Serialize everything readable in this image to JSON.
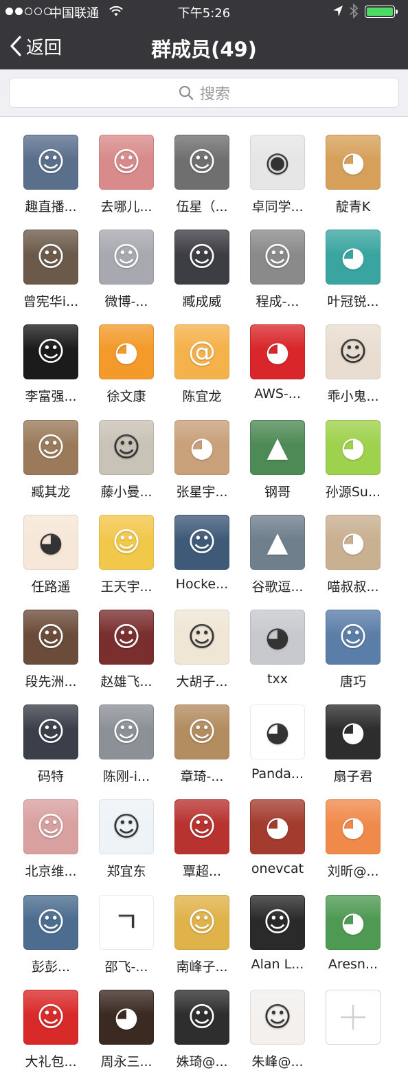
{
  "status_bar": {
    "carrier": "中国联通",
    "time": "下午5:26",
    "signal_bars_filled": 2,
    "signal_bars_total": 5,
    "battery_level": 1.0,
    "icons": [
      "wifi-icon",
      "location-arrow-icon",
      "bluetooth-icon",
      "battery-icon"
    ]
  },
  "nav": {
    "back_label": "返回",
    "title": "群成员(49)"
  },
  "search": {
    "placeholder": "搜索"
  },
  "colors": {
    "nav_bg": "#37373b",
    "search_bg": "#efeff4",
    "battery_green": "#4cd964"
  },
  "members": [
    {
      "name": "趣直播...",
      "color": "#5a6f8c",
      "glyph": "☺"
    },
    {
      "name": "去哪儿...",
      "color": "#d98a8a",
      "glyph": "☺"
    },
    {
      "name": "伍星（...",
      "color": "#6f6f6f",
      "glyph": "☺"
    },
    {
      "name": "卓同学...",
      "color": "#e6e6e6",
      "glyph": "◉"
    },
    {
      "name": "靛青K",
      "color": "#d6a05a",
      "glyph": "◕"
    },
    {
      "name": "曾宪华i...",
      "color": "#6b5a4a",
      "glyph": "☺"
    },
    {
      "name": "微博-...",
      "color": "#a8a8b0",
      "glyph": "☺"
    },
    {
      "name": "臧成威",
      "color": "#3d3d44",
      "glyph": "☺"
    },
    {
      "name": "程成-...",
      "color": "#8a8a8a",
      "glyph": "☺"
    },
    {
      "name": "叶冠锐...",
      "color": "#3aa5a0",
      "glyph": "◕"
    },
    {
      "name": "李富强...",
      "color": "#1b1b1b",
      "glyph": "☺"
    },
    {
      "name": "徐文康",
      "color": "#f39a2a",
      "glyph": "◕"
    },
    {
      "name": "陈宜龙",
      "color": "#f5b14a",
      "glyph": "@"
    },
    {
      "name": "AWS-...",
      "color": "#d9262a",
      "glyph": "◕"
    },
    {
      "name": "乖小鬼...",
      "color": "#e8ddd0",
      "glyph": "☺"
    },
    {
      "name": "臧其龙",
      "color": "#9a7a5a",
      "glyph": "☺"
    },
    {
      "name": "藤小曼...",
      "color": "#c9c2b6",
      "glyph": "☺"
    },
    {
      "name": "张星宇...",
      "color": "#c8a07a",
      "glyph": "◕"
    },
    {
      "name": "钢哥",
      "color": "#4e8a55",
      "glyph": "▲"
    },
    {
      "name": "孙源Su...",
      "color": "#9ed14c",
      "glyph": "◕"
    },
    {
      "name": "任路遥",
      "color": "#f6e7d8",
      "glyph": "◕"
    },
    {
      "name": "王天宇...",
      "color": "#f2c84b",
      "glyph": "☺"
    },
    {
      "name": "Hocke...",
      "color": "#3f5a78",
      "glyph": "☺"
    },
    {
      "name": "谷歌逗...",
      "color": "#6f7f8c",
      "glyph": "▲"
    },
    {
      "name": "喵叔叔...",
      "color": "#c9b090",
      "glyph": "◕"
    },
    {
      "name": "段先洲...",
      "color": "#6b4c3a",
      "glyph": "☺"
    },
    {
      "name": "赵雄飞...",
      "color": "#7a2e2e",
      "glyph": "☺"
    },
    {
      "name": "大胡子...",
      "color": "#f0e6d6",
      "glyph": "☺"
    },
    {
      "name": "txx",
      "color": "#c7c9cf",
      "glyph": "◕"
    },
    {
      "name": "唐巧",
      "color": "#5b7ea8",
      "glyph": "☺"
    },
    {
      "name": "码特",
      "color": "#3a3f4a",
      "glyph": "☺"
    },
    {
      "name": "陈刚-i...",
      "color": "#8c9198",
      "glyph": "☺"
    },
    {
      "name": "章琦-...",
      "color": "#b38c60",
      "glyph": "☺"
    },
    {
      "name": "Panda...",
      "color": "#ffffff",
      "glyph": "◕"
    },
    {
      "name": "扇子君",
      "color": "#2d2d2d",
      "glyph": "◕"
    },
    {
      "name": "北京维...",
      "color": "#d9a0a0",
      "glyph": "☺"
    },
    {
      "name": "郑宜东",
      "color": "#eef3f7",
      "glyph": "☺"
    },
    {
      "name": "覃超...",
      "color": "#b8322f",
      "glyph": "☺"
    },
    {
      "name": "onevcat",
      "color": "#a33b2e",
      "glyph": "◕"
    },
    {
      "name": "刘昕@...",
      "color": "#f08a4a",
      "glyph": "◕"
    },
    {
      "name": "彭彭...",
      "color": "#4c6d8f",
      "glyph": "☺"
    },
    {
      "name": "邵飞-...",
      "color": "#ffffff",
      "glyph": "ㄱ"
    },
    {
      "name": "南峰子...",
      "color": "#e0b24a",
      "glyph": "☺"
    },
    {
      "name": "Alan L...",
      "color": "#2a2a2a",
      "glyph": "☺"
    },
    {
      "name": "Aresn...",
      "color": "#4f9a53",
      "glyph": "◕"
    },
    {
      "name": "大礼包...",
      "color": "#d92a2a",
      "glyph": "☺"
    },
    {
      "name": "周永三...",
      "color": "#3a2a22",
      "glyph": "◕"
    },
    {
      "name": "姝琦@...",
      "color": "#2e2e2e",
      "glyph": "☺"
    },
    {
      "name": "朱峰@...",
      "color": "#f3f0ee",
      "glyph": "☺"
    }
  ],
  "add_member": {
    "icon": "plus-icon"
  }
}
